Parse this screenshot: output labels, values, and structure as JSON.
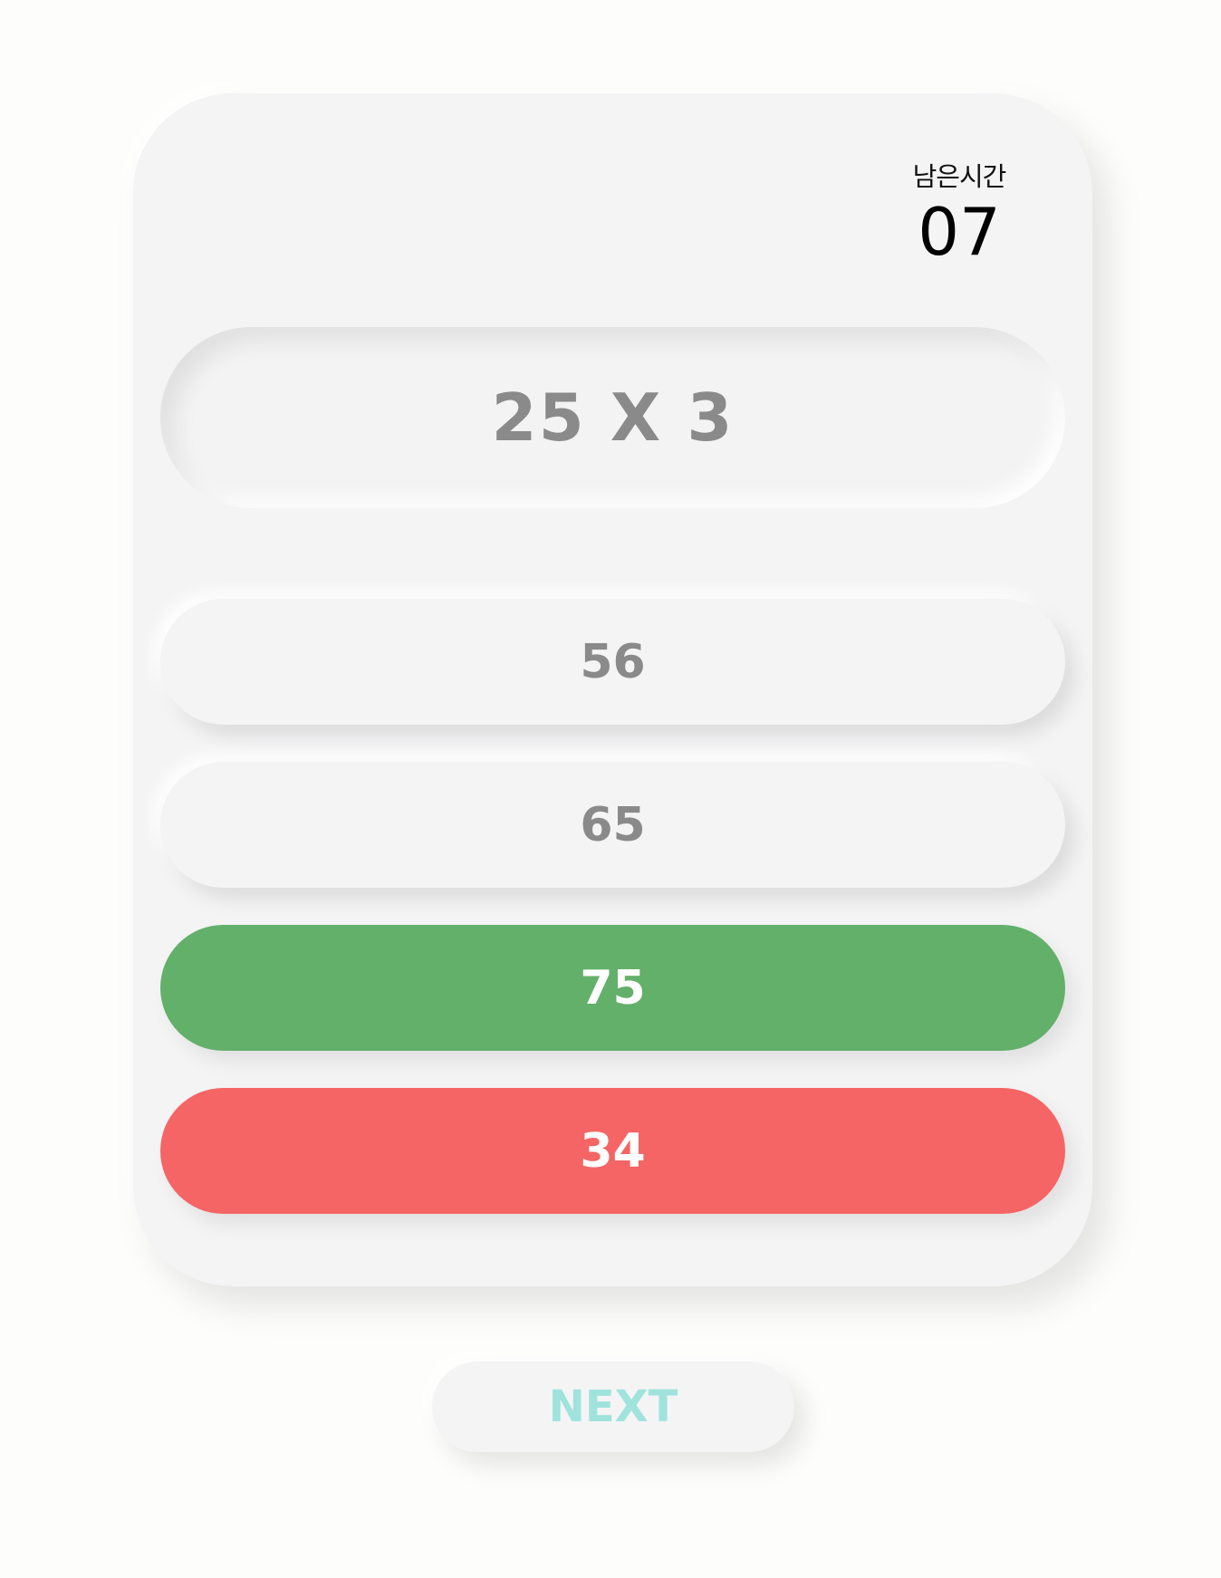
{
  "timer": {
    "label": "남은시간",
    "value": "07"
  },
  "question": {
    "text": "25 X 3"
  },
  "options": [
    {
      "label": "56",
      "state": "neutral"
    },
    {
      "label": "65",
      "state": "neutral"
    },
    {
      "label": "75",
      "state": "correct"
    },
    {
      "label": "34",
      "state": "wrong"
    }
  ],
  "next_button": {
    "label": "NEXT"
  },
  "colors": {
    "background": "#fdfdfb",
    "card": "#f4f4f5",
    "correct": "#63b06a",
    "wrong": "#f56565",
    "neutral_text": "#8a8a8a",
    "next_text": "#9fe3dc"
  }
}
